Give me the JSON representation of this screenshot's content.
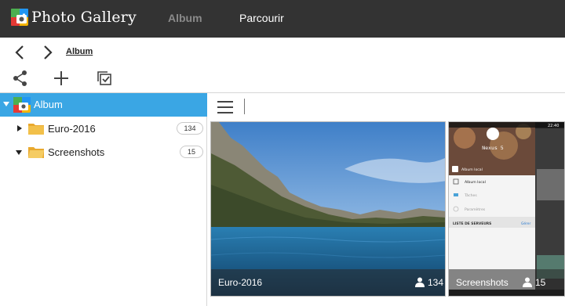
{
  "app": {
    "title": "Photo Gallery",
    "logo_icon": "photo-gallery-logo-icon"
  },
  "top_tabs": [
    {
      "label": "Album",
      "active": false
    },
    {
      "label": "Parcourir",
      "active": true
    }
  ],
  "nav": {
    "back_icon": "chevron-left-icon",
    "forward_icon": "chevron-right-icon",
    "breadcrumb": "Album"
  },
  "toolbar": {
    "share_icon": "share-icon",
    "add_icon": "plus-icon",
    "select_icon": "select-checkbox-icon"
  },
  "sidebar": {
    "root": {
      "label": "Album",
      "expanded": true
    },
    "items": [
      {
        "label": "Euro-2016",
        "count": "134",
        "expanded": false
      },
      {
        "label": "Screenshots",
        "count": "15",
        "expanded": true
      }
    ]
  },
  "content": {
    "menu_icon": "hamburger-menu-icon",
    "albums": [
      {
        "name": "Euro-2016",
        "count": "134"
      },
      {
        "name": "Screenshots",
        "count": "15"
      }
    ]
  },
  "phone_screenshot": {
    "device_name": "Nexus 5",
    "header_label": "Album local",
    "menu_items": [
      "Album local",
      "Tâches",
      "Paramètres"
    ],
    "section_label": "LISTE DE SERVEURS",
    "section_action": "Gérer",
    "time": "22:40"
  },
  "colors": {
    "topbar": "#333333",
    "selection": "#3aa6e4",
    "folder": "#f2c04a"
  }
}
